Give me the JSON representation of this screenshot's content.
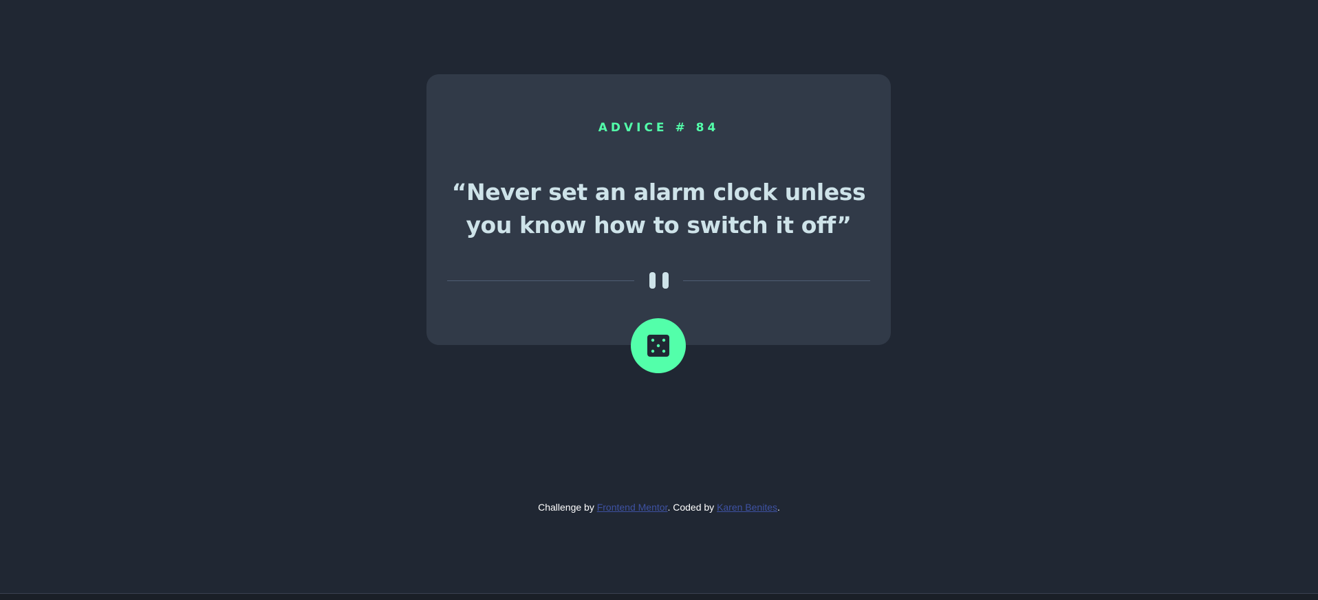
{
  "colors": {
    "background": "#202733",
    "card": "#313a48",
    "accent": "#53ffaa",
    "text": "#cee3e9",
    "link": "#3e52a3"
  },
  "advice": {
    "label": "ADVICE #",
    "number": "84",
    "quote": "“Never set an alarm clock unless you know how to switch it off”"
  },
  "divider": {
    "icon": "pause-icon"
  },
  "button": {
    "icon": "dice-icon"
  },
  "footer": {
    "prefix": "Challenge by",
    "link1": "Frontend Mentor",
    "middle": ". Coded by",
    "link2": "Karen Benites",
    "suffix": "."
  }
}
